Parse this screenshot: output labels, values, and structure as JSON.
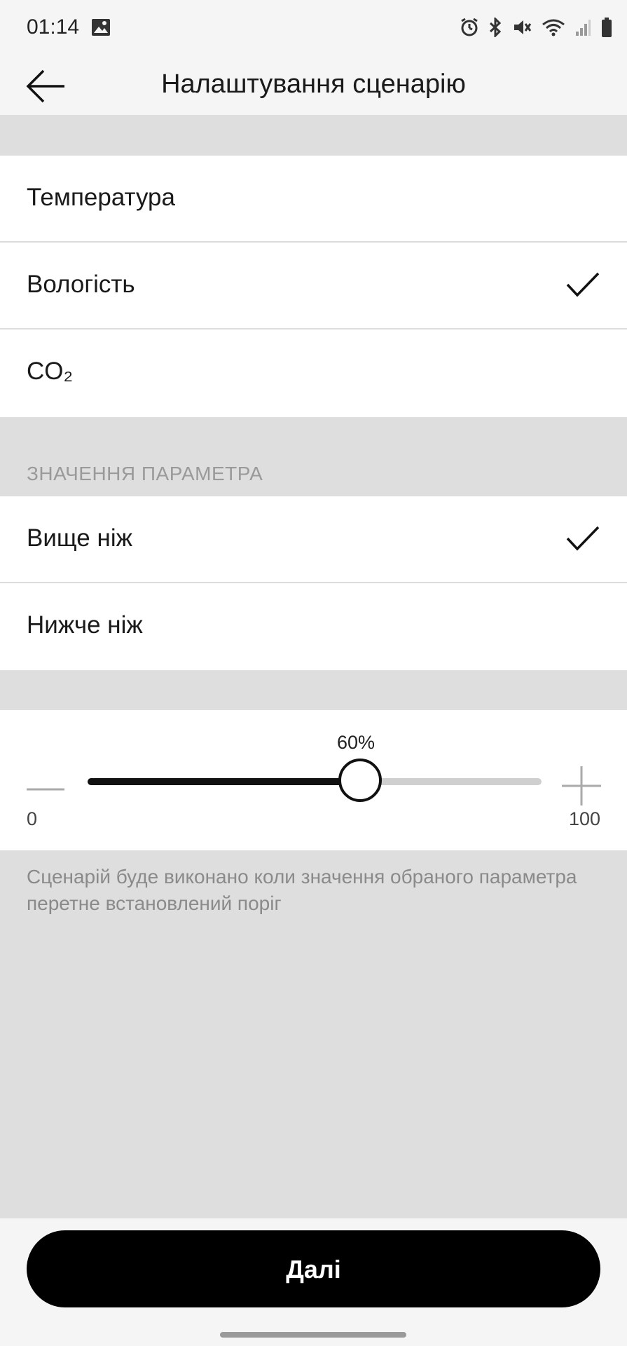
{
  "status_bar": {
    "time": "01:14",
    "icons": [
      "image-icon",
      "alarm-icon",
      "bluetooth-icon",
      "mute-icon",
      "wifi-icon",
      "signal-icon",
      "battery-icon"
    ]
  },
  "header": {
    "title": "Налаштування сценарію",
    "back_icon": "arrow-left-icon"
  },
  "parameters": [
    {
      "label": "Температура",
      "selected": false
    },
    {
      "label": "Вологість",
      "selected": true
    },
    {
      "label": "CO₂",
      "selected": false
    }
  ],
  "condition_section": {
    "header": "ЗНАЧЕННЯ ПАРАМЕТРА",
    "options": [
      {
        "label": "Вище ніж",
        "selected": true
      },
      {
        "label": "Нижче ніж",
        "selected": false
      }
    ]
  },
  "slider": {
    "value_label": "60%",
    "value": 60,
    "min_label": "0",
    "max_label": "100",
    "min": 0,
    "max": 100
  },
  "hint": "Сценарій буде виконано коли значення обраного параметра перетне встановлений поріг",
  "next_button": {
    "label": "Далі"
  },
  "colors": {
    "accent": "#000000",
    "background": "#dedede",
    "card": "#ffffff"
  }
}
